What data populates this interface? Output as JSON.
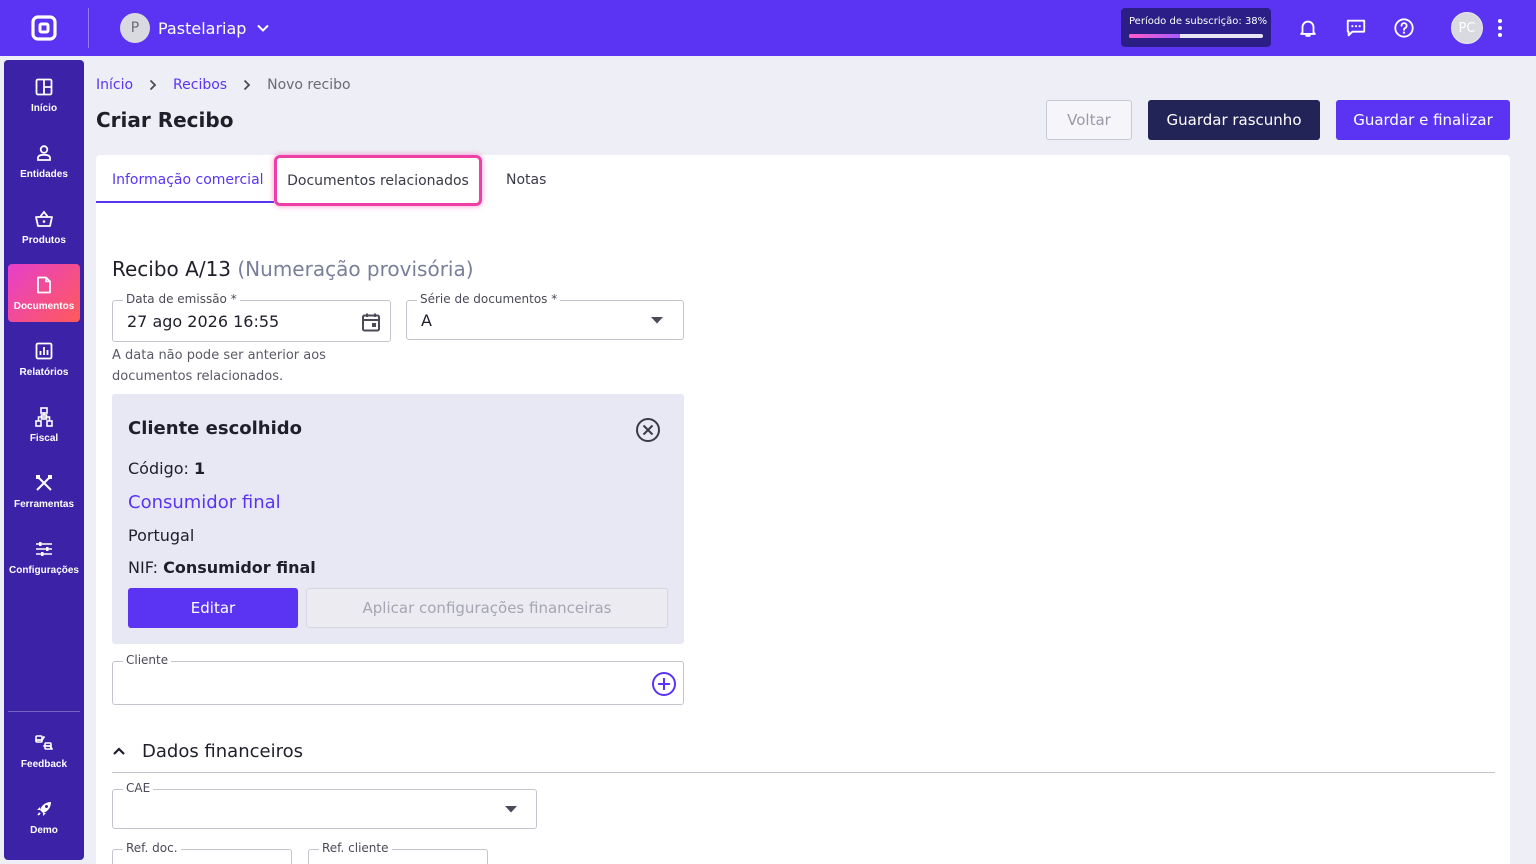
{
  "topbar": {
    "company_initial": "P",
    "company_name": "Pastelariap",
    "subscription_label": "Período de subscrição: 38%",
    "subscription_progress": 0.38,
    "user_initials": "PC"
  },
  "sidebar": {
    "items": [
      {
        "label": "Início",
        "icon": "grid-icon"
      },
      {
        "label": "Entidades",
        "icon": "person-icon"
      },
      {
        "label": "Produtos",
        "icon": "basket-icon"
      },
      {
        "label": "Documentos",
        "icon": "document-icon"
      },
      {
        "label": "Relatórios",
        "icon": "report-icon"
      },
      {
        "label": "Fiscal",
        "icon": "hierarchy-icon"
      },
      {
        "label": "Ferramentas",
        "icon": "tools-icon"
      },
      {
        "label": "Configurações",
        "icon": "sliders-icon"
      }
    ],
    "bottom": [
      {
        "label": "Feedback",
        "icon": "feedback-icon"
      },
      {
        "label": "Demo",
        "icon": "rocket-icon"
      }
    ]
  },
  "breadcrumb": {
    "home": "Início",
    "receipts": "Recibos",
    "current": "Novo recibo"
  },
  "page": {
    "title": "Criar Recibo",
    "back_label": "Voltar",
    "draft_label": "Guardar rascunho",
    "finalize_label": "Guardar e finalizar"
  },
  "tabs": {
    "info": "Informação comercial",
    "docs": "Documentos relacionados",
    "notes": "Notas"
  },
  "form": {
    "receipt_title": "Recibo A/13",
    "receipt_note": "(Numeração provisória)",
    "issue_date_label": "Data de emissão *",
    "issue_date_value": "27 ago 2026 16:55",
    "series_label": "Série de documentos *",
    "series_value": "A",
    "date_helper": "A data não pode ser anterior aos documentos relacionados.",
    "client_label": "Cliente",
    "client_value": "",
    "financial_section": "Dados financeiros",
    "cae_label": "CAE",
    "ref_doc_label": "Ref. doc.",
    "ref_client_label": "Ref. cliente"
  },
  "client": {
    "title": "Cliente escolhido",
    "code_label": "Código:",
    "code_value": "1",
    "name": "Consumidor final",
    "country": "Portugal",
    "nif_label": "NIF:",
    "nif_value": "Consumidor final",
    "edit_label": "Editar",
    "apply_label": "Aplicar configurações financeiras"
  },
  "colors": {
    "brand": "#5a34f2",
    "sidebar": "#3b22a6",
    "highlight": "#ee3fa6"
  }
}
